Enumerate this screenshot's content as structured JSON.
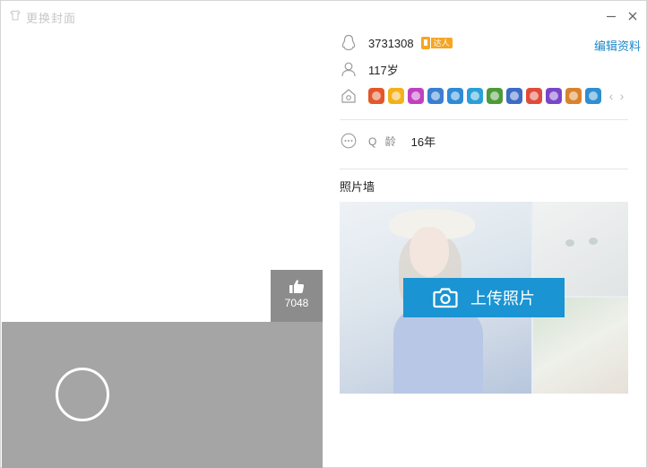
{
  "window": {
    "title": "更换封面",
    "minimize_icon": "minimize-icon",
    "close_icon": "close-icon"
  },
  "cover": {
    "like_count": "7048",
    "like_icon": "thumbs-up-icon"
  },
  "profile": {
    "qq_number": "3731308",
    "daren_tag": "达人",
    "edit_label": "编辑资料",
    "age": "117岁",
    "q_age_label": "Q 龄",
    "q_age_value": "16年"
  },
  "badges": [
    {
      "name": "badge-1",
      "color": "#e2572b"
    },
    {
      "name": "badge-2",
      "color": "#f3b21b"
    },
    {
      "name": "badge-3",
      "color": "#c040c0"
    },
    {
      "name": "badge-4",
      "color": "#3a7fd0"
    },
    {
      "name": "badge-5",
      "color": "#2e8bd6"
    },
    {
      "name": "badge-6",
      "color": "#2aa0d8"
    },
    {
      "name": "badge-7",
      "color": "#4d9a3a"
    },
    {
      "name": "badge-8",
      "color": "#3d6cc4"
    },
    {
      "name": "badge-9",
      "color": "#e04b3a"
    },
    {
      "name": "badge-10",
      "color": "#7a46c8"
    },
    {
      "name": "badge-11",
      "color": "#d9832c"
    },
    {
      "name": "badge-12",
      "color": "#2f8fd0"
    }
  ],
  "photo_wall": {
    "title": "照片墙",
    "upload_label": "上传照片"
  },
  "colors": {
    "accent": "#1a94d2",
    "link": "#1e88c7",
    "cover_gray": "#a5a5a5"
  }
}
